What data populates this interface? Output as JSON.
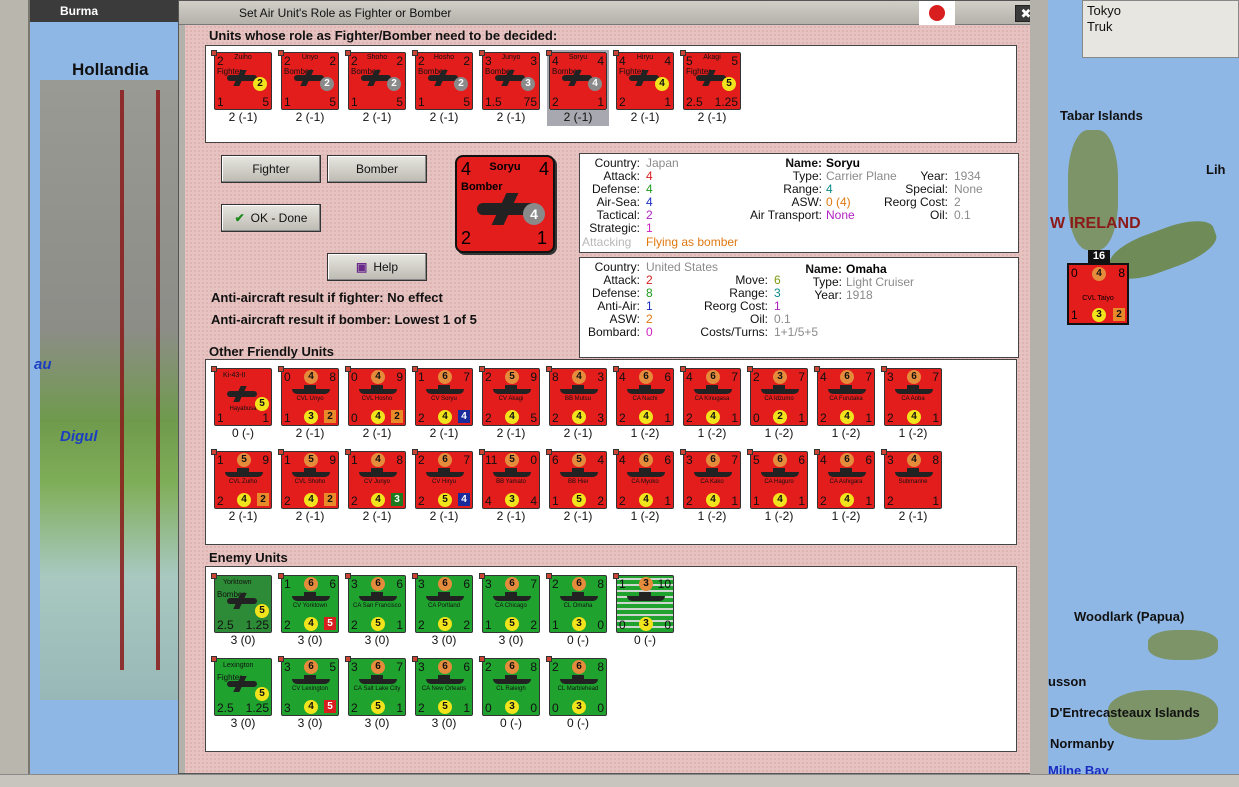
{
  "window": {
    "title": "Set Air Unit's Role as Fighter or Bomber",
    "map_tab": "Burma",
    "close_symbol": "✖"
  },
  "map": {
    "left_labels": {
      "hollandia": "Hollandia",
      "digul": "Digul",
      "au": "au"
    },
    "right_labels": {
      "tabar": "Tabar Islands",
      "lih": "Lih",
      "new_ireland": "W IRELAND",
      "woodlark": "Woodlark (Papua)",
      "busson": "usson",
      "dentrecasteaux": "D'Entrecasteaux Islands",
      "normanby": "Normanby",
      "milne": "Milne Bay"
    },
    "city_list": [
      "Tokyo",
      "Truk"
    ],
    "stack_count": "16",
    "map_counter": {
      "name": "CVL Taiyo",
      "tl": "0",
      "top": "4",
      "tr": "8",
      "bl": "1",
      "mid": "3",
      "br": "2"
    }
  },
  "undecided": {
    "header": "Units whose role as Fighter/Bomber need to be decided:",
    "units": [
      {
        "name": "Zuiho",
        "role": "Fighter",
        "tl": "2",
        "tr": "",
        "bl": "1",
        "br": "5",
        "circle": "2",
        "circle_color": "ye",
        "label": "2 (-1)"
      },
      {
        "name": "Unyo",
        "role": "Bomber",
        "tl": "2",
        "tr": "2",
        "bl": "1",
        "br": "5",
        "circle": "2",
        "circle_color": "gr",
        "label": "2 (-1)"
      },
      {
        "name": "Shoho",
        "role": "Bomber",
        "tl": "2",
        "tr": "2",
        "bl": "1",
        "br": "5",
        "circle": "2",
        "circle_color": "gr",
        "label": "2 (-1)"
      },
      {
        "name": "Hosho",
        "role": "Bomber",
        "tl": "2",
        "tr": "2",
        "bl": "1",
        "br": "5",
        "circle": "2",
        "circle_color": "gr",
        "label": "2 (-1)"
      },
      {
        "name": "Junyo",
        "role": "Bomber",
        "tl": "3",
        "tr": "3",
        "bl": "1.5",
        "br": "75",
        "circle": "3",
        "circle_color": "gr",
        "label": "2 (-1)"
      },
      {
        "name": "Soryu",
        "role": "Bomber",
        "tl": "4",
        "tr": "4",
        "bl": "2",
        "br": "1",
        "circle": "4",
        "circle_color": "gr",
        "label": "2 (-1)",
        "selected": true
      },
      {
        "name": "Hiryu",
        "role": "Fighter",
        "tl": "4",
        "tr": "4",
        "bl": "2",
        "br": "1",
        "circle": "4",
        "circle_color": "ye",
        "label": "2 (-1)"
      },
      {
        "name": "Akagi",
        "role": "Fighter",
        "tl": "5",
        "tr": "5",
        "bl": "2.5",
        "br": "1.25",
        "circle": "5",
        "circle_color": "ye",
        "label": "2 (-1)"
      }
    ]
  },
  "buttons": {
    "fighter": "Fighter",
    "bomber": "Bomber",
    "ok": "OK - Done",
    "help": "Help"
  },
  "big_counter": {
    "name": "Soryu",
    "role": "Bomber",
    "tl": "4",
    "tr": "4",
    "bl": "2",
    "br": "1",
    "circle": "4"
  },
  "aa": {
    "fighter": "Anti-aircraft result if fighter:  No effect",
    "bomber": "Anti-aircraft result if bomber:  Lowest 1 of 5"
  },
  "air_info": {
    "country_label": "Country:",
    "country": "Japan",
    "attack_label": "Attack:",
    "attack": "4",
    "defense_label": "Defense:",
    "defense": "4",
    "airsea_label": "Air-Sea:",
    "airsea": "4",
    "tactical_label": "Tactical:",
    "tactical": "2",
    "strategic_label": "Strategic:",
    "strategic": "1",
    "attacking_label": "Attacking",
    "attacking": "Flying as bomber",
    "name_label": "Name:",
    "name": "Soryu",
    "type_label": "Type:",
    "type": "Carrier Plane",
    "year_label": "Year:",
    "year": "1934",
    "range_label": "Range:",
    "range": "4",
    "special_label": "Special:",
    "special": "None",
    "asw_label": "ASW:",
    "asw": "0 (4)",
    "reorg_label": "Reorg Cost:",
    "reorg": "2",
    "airtransport_label": "Air Transport:",
    "airtransport": "None",
    "oil_label": "Oil:",
    "oil": "0.1"
  },
  "ship_info": {
    "country_label": "Country:",
    "country": "United States",
    "attack_label": "Attack:",
    "attack": "2",
    "defense_label": "Defense:",
    "defense": "8",
    "antiair_label": "Anti-Air:",
    "antiair": "1",
    "asw_label": "ASW:",
    "asw": "2",
    "bombard_label": "Bombard:",
    "bombard": "0",
    "move_label": "Move:",
    "move": "6",
    "range_label": "Range:",
    "range": "3",
    "reorg_label": "Reorg Cost:",
    "reorg": "1",
    "oil_label": "Oil:",
    "oil": "0.1",
    "costs_label": "Costs/Turns:",
    "costs": "1+1/5+5",
    "name_label": "Name:",
    "name": "Omaha",
    "type_label": "Type:",
    "type": "Light Cruiser",
    "year_label": "Year:",
    "year": "1918"
  },
  "friendly": {
    "header": "Other Friendly Units",
    "units": [
      {
        "kind": "plane",
        "name": "Ki-43-II",
        "sub": "Hayabusa",
        "tl": "",
        "top": "",
        "tr": "",
        "bl": "1",
        "mid": "5",
        "br": "1",
        "sq": "",
        "sq_color": "",
        "label": "0 (-)"
      },
      {
        "kind": "ship",
        "name": "CVL Unyo",
        "tl": "0",
        "top": "4",
        "tr": "8",
        "bl": "1",
        "mid": "3",
        "br": "",
        "sq": "2",
        "sq_color": "org",
        "label": "2 (-1)"
      },
      {
        "kind": "ship",
        "name": "CVL Hosho",
        "tl": "0",
        "top": "4",
        "tr": "9",
        "bl": "0",
        "mid": "4",
        "br": "",
        "sq": "2",
        "sq_color": "org",
        "label": "2 (-1)"
      },
      {
        "kind": "ship",
        "name": "CV Soryu",
        "tl": "1",
        "top": "6",
        "tr": "7",
        "bl": "2",
        "mid": "4",
        "br": "",
        "sq": "4",
        "sq_color": "blu",
        "label": "2 (-1)"
      },
      {
        "kind": "ship",
        "name": "CV Akagi",
        "tl": "2",
        "top": "5",
        "tr": "9",
        "bl": "2",
        "mid": "4",
        "br": "5",
        "sq": "",
        "sq_color": "",
        "label": "2 (-1)"
      },
      {
        "kind": "ship",
        "name": "BB Mutsu",
        "tl": "8",
        "top": "4",
        "tr": "3",
        "bl": "2",
        "mid": "4",
        "br": "3",
        "sq": "",
        "sq_color": "",
        "label": "2 (-1)"
      },
      {
        "kind": "ship",
        "name": "CA Nachi",
        "tl": "4",
        "top": "6",
        "tr": "6",
        "bl": "2",
        "mid": "4",
        "br": "1",
        "sq": "",
        "sq_color": "",
        "label": "1 (-2)"
      },
      {
        "kind": "ship",
        "name": "CA Kinugasa",
        "tl": "4",
        "top": "6",
        "tr": "7",
        "bl": "2",
        "mid": "4",
        "br": "1",
        "sq": "",
        "sq_color": "",
        "label": "1 (-2)"
      },
      {
        "kind": "ship",
        "name": "CA Idzumo",
        "tl": "2",
        "top": "3",
        "tr": "7",
        "bl": "0",
        "mid": "2",
        "br": "1",
        "sq": "",
        "sq_color": "",
        "label": "1 (-2)"
      },
      {
        "kind": "ship",
        "name": "CA Furutaka",
        "tl": "4",
        "top": "6",
        "tr": "7",
        "bl": "2",
        "mid": "4",
        "br": "1",
        "sq": "",
        "sq_color": "",
        "label": "1 (-2)"
      },
      {
        "kind": "ship",
        "name": "CA Aoba",
        "tl": "3",
        "top": "6",
        "tr": "7",
        "bl": "2",
        "mid": "4",
        "br": "1",
        "sq": "",
        "sq_color": "",
        "label": "1 (-2)"
      },
      {
        "kind": "ship",
        "name": "CVL Zuiho",
        "tl": "1",
        "top": "5",
        "tr": "9",
        "bl": "2",
        "mid": "4",
        "br": "",
        "sq": "2",
        "sq_color": "org",
        "label": "2 (-1)"
      },
      {
        "kind": "ship",
        "name": "CVL Shoho",
        "tl": "1",
        "top": "5",
        "tr": "9",
        "bl": "2",
        "mid": "4",
        "br": "",
        "sq": "2",
        "sq_color": "org",
        "label": "2 (-1)"
      },
      {
        "kind": "ship",
        "name": "CV Junyo",
        "tl": "1",
        "top": "4",
        "tr": "8",
        "bl": "2",
        "mid": "4",
        "br": "",
        "sq": "3",
        "sq_color": "grn",
        "label": "2 (-1)"
      },
      {
        "kind": "ship",
        "name": "CV Hiryu",
        "tl": "2",
        "top": "6",
        "tr": "7",
        "bl": "2",
        "mid": "5",
        "br": "",
        "sq": "4",
        "sq_color": "blu",
        "label": "2 (-1)"
      },
      {
        "kind": "ship",
        "name": "BB Yamato",
        "tl": "11",
        "top": "5",
        "tr": "0",
        "bl": "4",
        "mid": "3",
        "br": "4",
        "sq": "",
        "sq_color": "",
        "label": "2 (-1)"
      },
      {
        "kind": "ship",
        "name": "BB Hiei",
        "tl": "6",
        "top": "5",
        "tr": "4",
        "bl": "1",
        "mid": "5",
        "br": "2",
        "sq": "",
        "sq_color": "",
        "label": "2 (-1)"
      },
      {
        "kind": "ship",
        "name": "CA Myoko",
        "tl": "4",
        "top": "6",
        "tr": "6",
        "bl": "2",
        "mid": "4",
        "br": "1",
        "sq": "",
        "sq_color": "",
        "label": "1 (-2)"
      },
      {
        "kind": "ship",
        "name": "CA Kako",
        "tl": "3",
        "top": "6",
        "tr": "7",
        "bl": "2",
        "mid": "4",
        "br": "1",
        "sq": "",
        "sq_color": "",
        "label": "1 (-2)"
      },
      {
        "kind": "ship",
        "name": "CA Haguro",
        "tl": "5",
        "top": "6",
        "tr": "6",
        "bl": "1",
        "mid": "4",
        "br": "1",
        "sq": "",
        "sq_color": "",
        "label": "1 (-2)"
      },
      {
        "kind": "ship",
        "name": "CA Ashigara",
        "tl": "4",
        "top": "6",
        "tr": "6",
        "bl": "2",
        "mid": "4",
        "br": "1",
        "sq": "",
        "sq_color": "",
        "label": "1 (-2)"
      },
      {
        "kind": "ship",
        "name": "Submarine",
        "tl": "3",
        "top": "4",
        "tr": "8",
        "bl": "2",
        "mid": "",
        "br": "1",
        "sq": "",
        "sq_color": "",
        "label": "2 (-1)"
      }
    ]
  },
  "enemy": {
    "header": "Enemy Units",
    "units": [
      {
        "kind": "plane",
        "name": "Yorktown",
        "role": "Bomber",
        "tl": "",
        "top": "",
        "tr": "",
        "bl": "2.5",
        "mid": "5",
        "br": "1.25",
        "sq": "",
        "sq_color": "",
        "label": "3 (0)",
        "gray": true
      },
      {
        "kind": "ship",
        "name": "CV Yorktown",
        "tl": "1",
        "top": "6",
        "tr": "6",
        "bl": "2",
        "mid": "4",
        "br": "",
        "sq": "5",
        "sq_color": "red",
        "label": "3 (0)"
      },
      {
        "kind": "ship",
        "name": "CA San Francisco",
        "tl": "3",
        "top": "6",
        "tr": "6",
        "bl": "2",
        "mid": "5",
        "br": "1",
        "sq": "",
        "sq_color": "",
        "label": "3 (0)"
      },
      {
        "kind": "ship",
        "name": "CA Portland",
        "tl": "3",
        "top": "6",
        "tr": "6",
        "bl": "2",
        "mid": "5",
        "br": "2",
        "sq": "",
        "sq_color": "",
        "label": "3 (0)"
      },
      {
        "kind": "ship",
        "name": "CA Chicago",
        "tl": "3",
        "top": "6",
        "tr": "7",
        "bl": "1",
        "mid": "5",
        "br": "2",
        "sq": "",
        "sq_color": "",
        "label": "3 (0)"
      },
      {
        "kind": "ship",
        "name": "CL Omaha",
        "tl": "2",
        "top": "6",
        "tr": "8",
        "bl": "1",
        "mid": "3",
        "br": "0",
        "sq": "",
        "sq_color": "",
        "label": "0 (-)"
      },
      {
        "kind": "ship",
        "name": "",
        "tl": "1",
        "top": "3",
        "tr": "10",
        "bl": "0",
        "mid": "3",
        "br": "0",
        "sq": "",
        "sq_color": "",
        "label": "0 (-)",
        "striped": true
      },
      {
        "kind": "plane",
        "name": "Lexington",
        "role": "Fighter",
        "tl": "",
        "top": "",
        "tr": "",
        "bl": "2.5",
        "mid": "5",
        "br": "1.25",
        "sq": "",
        "sq_color": "",
        "label": "3 (0)",
        "gray": false
      },
      {
        "kind": "ship",
        "name": "CV Lexington",
        "tl": "3",
        "top": "6",
        "tr": "5",
        "bl": "3",
        "mid": "4",
        "br": "",
        "sq": "5",
        "sq_color": "red",
        "label": "3 (0)"
      },
      {
        "kind": "ship",
        "name": "CA Salt Lake City",
        "tl": "3",
        "top": "6",
        "tr": "7",
        "bl": "2",
        "mid": "5",
        "br": "1",
        "sq": "",
        "sq_color": "",
        "label": "3 (0)"
      },
      {
        "kind": "ship",
        "name": "CA New Orleans",
        "tl": "3",
        "top": "6",
        "tr": "6",
        "bl": "2",
        "mid": "5",
        "br": "1",
        "sq": "",
        "sq_color": "",
        "label": "3 (0)"
      },
      {
        "kind": "ship",
        "name": "CL Raleigh",
        "tl": "2",
        "top": "6",
        "tr": "8",
        "bl": "0",
        "mid": "3",
        "br": "0",
        "sq": "",
        "sq_color": "",
        "label": "0 (-)"
      },
      {
        "kind": "ship",
        "name": "CL Marblehead",
        "tl": "2",
        "top": "6",
        "tr": "8",
        "bl": "0",
        "mid": "3",
        "br": "0",
        "sq": "",
        "sq_color": "",
        "label": "0 (-)"
      }
    ]
  }
}
